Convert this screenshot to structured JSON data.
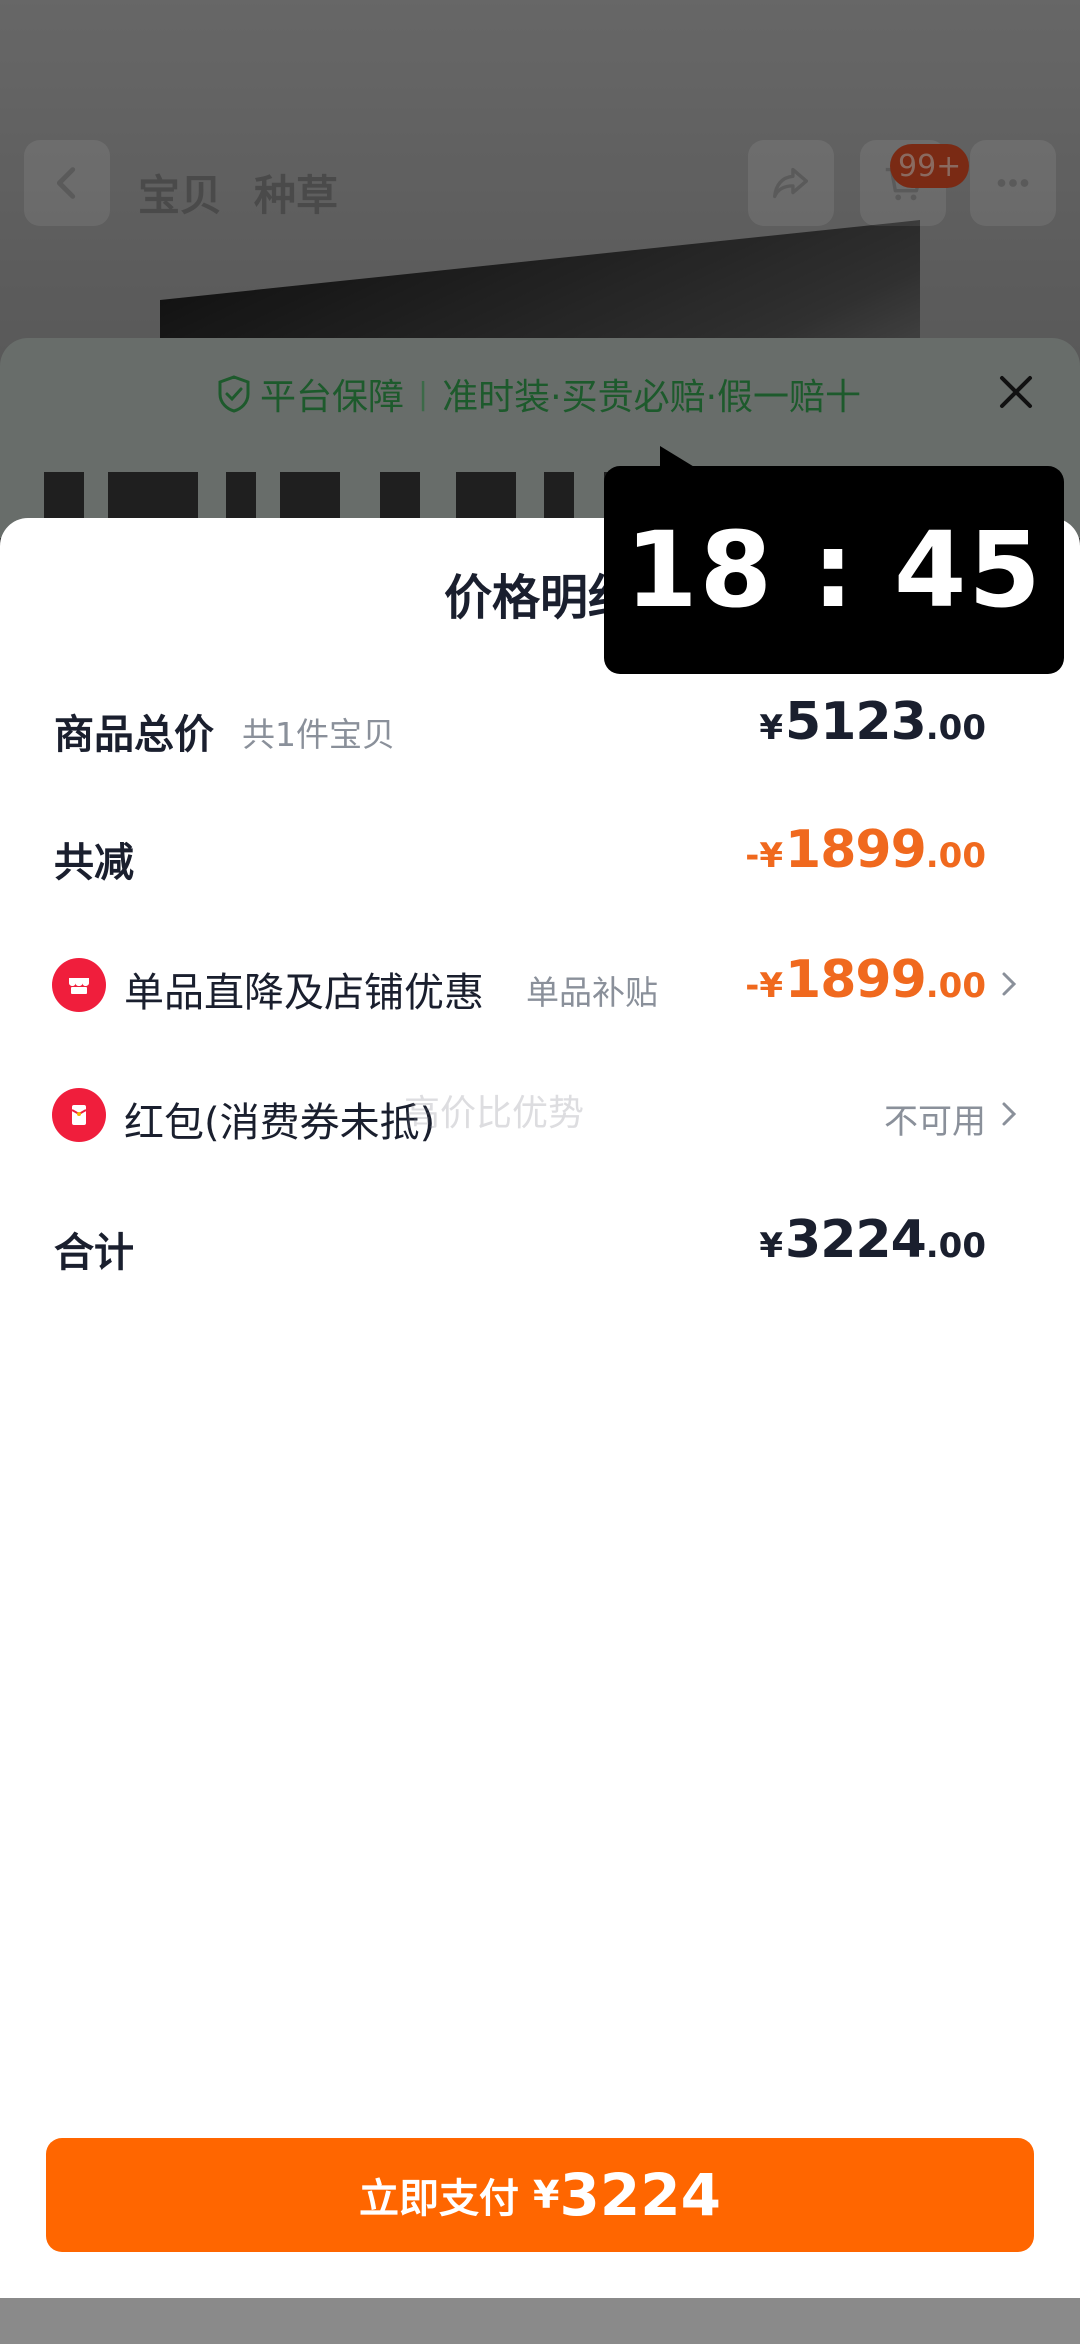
{
  "nav": {
    "tab1": "宝贝",
    "tab2": "种草",
    "cart_badge": "99+"
  },
  "guarantee": {
    "platform": "平台保障",
    "separator": "|",
    "items": "准时装·买贵必赔·假一赔十"
  },
  "sheet": {
    "title": "价格明细"
  },
  "rows": {
    "total": {
      "label": "商品总价",
      "sub": "共1件宝贝",
      "yen": "¥",
      "int": "5123",
      "dec": ".00"
    },
    "reduce": {
      "label": "共减",
      "yen": "-¥",
      "int": "1899",
      "dec": ".00"
    },
    "discount": {
      "label": "单品直降及店铺优惠",
      "sub": "单品补贴",
      "yen": "-¥",
      "int": "1899",
      "dec": ".00"
    },
    "redpacket": {
      "label": "红包(消费券未抵)",
      "status": "不可用"
    },
    "sum": {
      "label": "合计",
      "yen": "¥",
      "int": "3224",
      "dec": ".00"
    }
  },
  "watermark": "高价比优势",
  "pay_button": {
    "label": "立即支付",
    "yen": "¥",
    "amount": "3224"
  },
  "timer": "18 : 45",
  "colors": {
    "accent_orange": "#FF6600",
    "price_orange": "#F0691E",
    "text_dark": "#1A1F2E",
    "text_grey": "#8A909A",
    "guarantee_green": "#1D5A2C",
    "icon_red": "#F01E3C"
  },
  "icons": {
    "back": "chevron-left-icon",
    "share": "share-icon",
    "cart": "cart-icon",
    "more": "more-icon",
    "shield": "shield-check-icon",
    "close": "close-icon",
    "shop": "shop-icon",
    "redpacket": "red-packet-icon",
    "chevron": "chevron-right-icon"
  }
}
